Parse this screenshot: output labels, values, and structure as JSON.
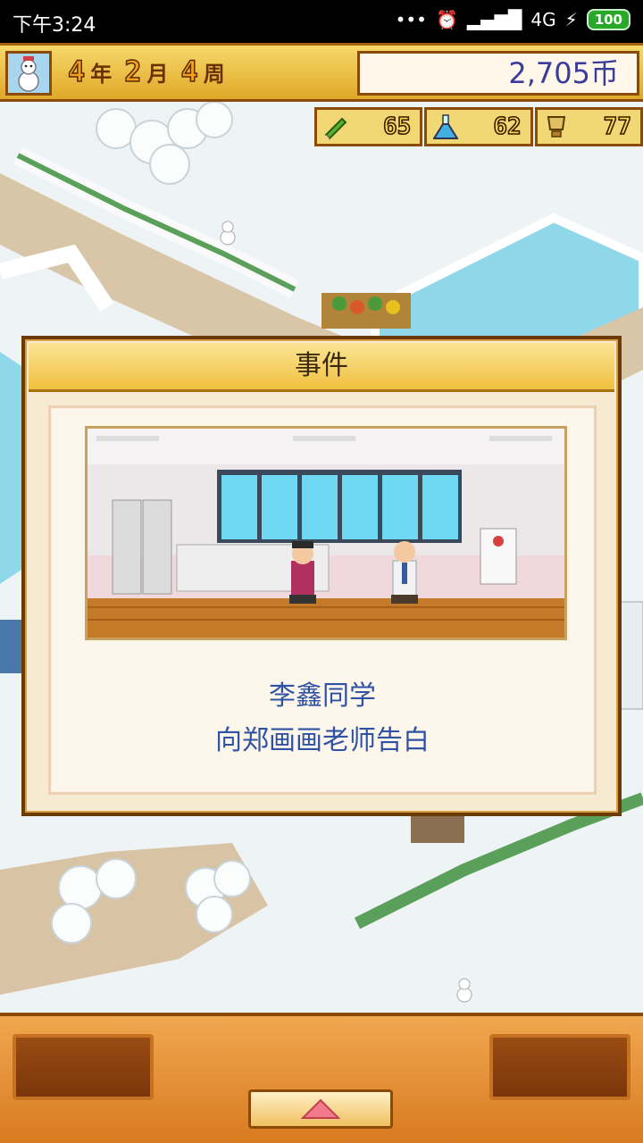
{
  "status_bar": {
    "time": "下午3:24",
    "network": "4G",
    "battery": "100"
  },
  "top_hud": {
    "year": "4",
    "year_label": "年",
    "month": "2",
    "month_label": "月",
    "week": "4",
    "week_label": "周",
    "money": "2,705币"
  },
  "stats": [
    {
      "icon": "pencil-icon",
      "value": "65"
    },
    {
      "icon": "flask-icon",
      "value": "62"
    },
    {
      "icon": "trophy-icon",
      "value": "77"
    }
  ],
  "event": {
    "title": "事件",
    "line1": "李鑫同学",
    "line2": "向郑画画老师告白"
  },
  "bottom_bar": {
    "arrow": "▲"
  }
}
